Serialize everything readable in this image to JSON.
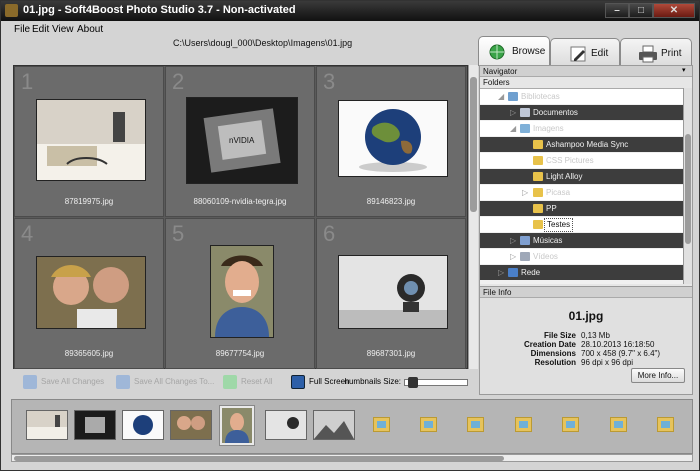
{
  "window": {
    "title": "01.jpg - Soft4Boost Photo Studio 3.7 - Non-activated",
    "controls": [
      "–",
      "□",
      "✕"
    ]
  },
  "menu": [
    "File",
    "Edit",
    "View",
    "About"
  ],
  "path": "C:\\Users\\dougl_000\\Desktop\\Imagens\\01.jpg",
  "tabs": [
    {
      "label": "Browse",
      "icon": "globe-icon"
    },
    {
      "label": "Edit",
      "icon": "pencil-icon"
    },
    {
      "label": "Print",
      "icon": "printer-icon"
    }
  ],
  "thumbnails": [
    {
      "num": "1",
      "file": "87819975.jpg"
    },
    {
      "num": "2",
      "file": "88060109-nvidia-tegra.jpg"
    },
    {
      "num": "3",
      "file": "89146823.jpg"
    },
    {
      "num": "4",
      "file": "89365605.jpg"
    },
    {
      "num": "5",
      "file": "89677754.jpg"
    },
    {
      "num": "6",
      "file": "89687301.jpg"
    }
  ],
  "navigator": {
    "header": "Navigator",
    "folders_label": "Folders"
  },
  "tree": [
    {
      "label": "Bibliotecas"
    },
    {
      "label": "Documentos"
    },
    {
      "label": "Imagens"
    },
    {
      "label": "Ashampoo Media Sync"
    },
    {
      "label": "CSS Pictures"
    },
    {
      "label": "Light Alloy"
    },
    {
      "label": "Picasa"
    },
    {
      "label": "PP"
    },
    {
      "label": "Testes"
    },
    {
      "label": "Músicas"
    },
    {
      "label": "Vídeos"
    },
    {
      "label": "Rede"
    }
  ],
  "file_info": {
    "header": "File Info",
    "name": "01.jpg",
    "rows": [
      {
        "k": "File Size",
        "v": "0,13 Mb"
      },
      {
        "k": "Creation Date",
        "v": "28.10.2013  16:18:50"
      },
      {
        "k": "Dimensions",
        "v": "700 x 458 (9.7\" x 6.4\")"
      },
      {
        "k": "Resolution",
        "v": "96 dpi x 96 dpi"
      }
    ],
    "more_button": "More Info..."
  },
  "toolbar": {
    "save_all": "Save All Changes",
    "save_all_to": "Save All Changes To...",
    "reset_all": "Reset All",
    "full_screen": "Full Screen",
    "thumbnails_size": "Thumbnails Size:"
  },
  "strip": {
    "thumbs_count": 7,
    "placeholders_count": 7
  },
  "colors": {
    "accent": "#3d3d3d",
    "folder": "#e8c24a",
    "save_icon": "#4a7fd0",
    "reset_icon": "#2fa84a"
  }
}
